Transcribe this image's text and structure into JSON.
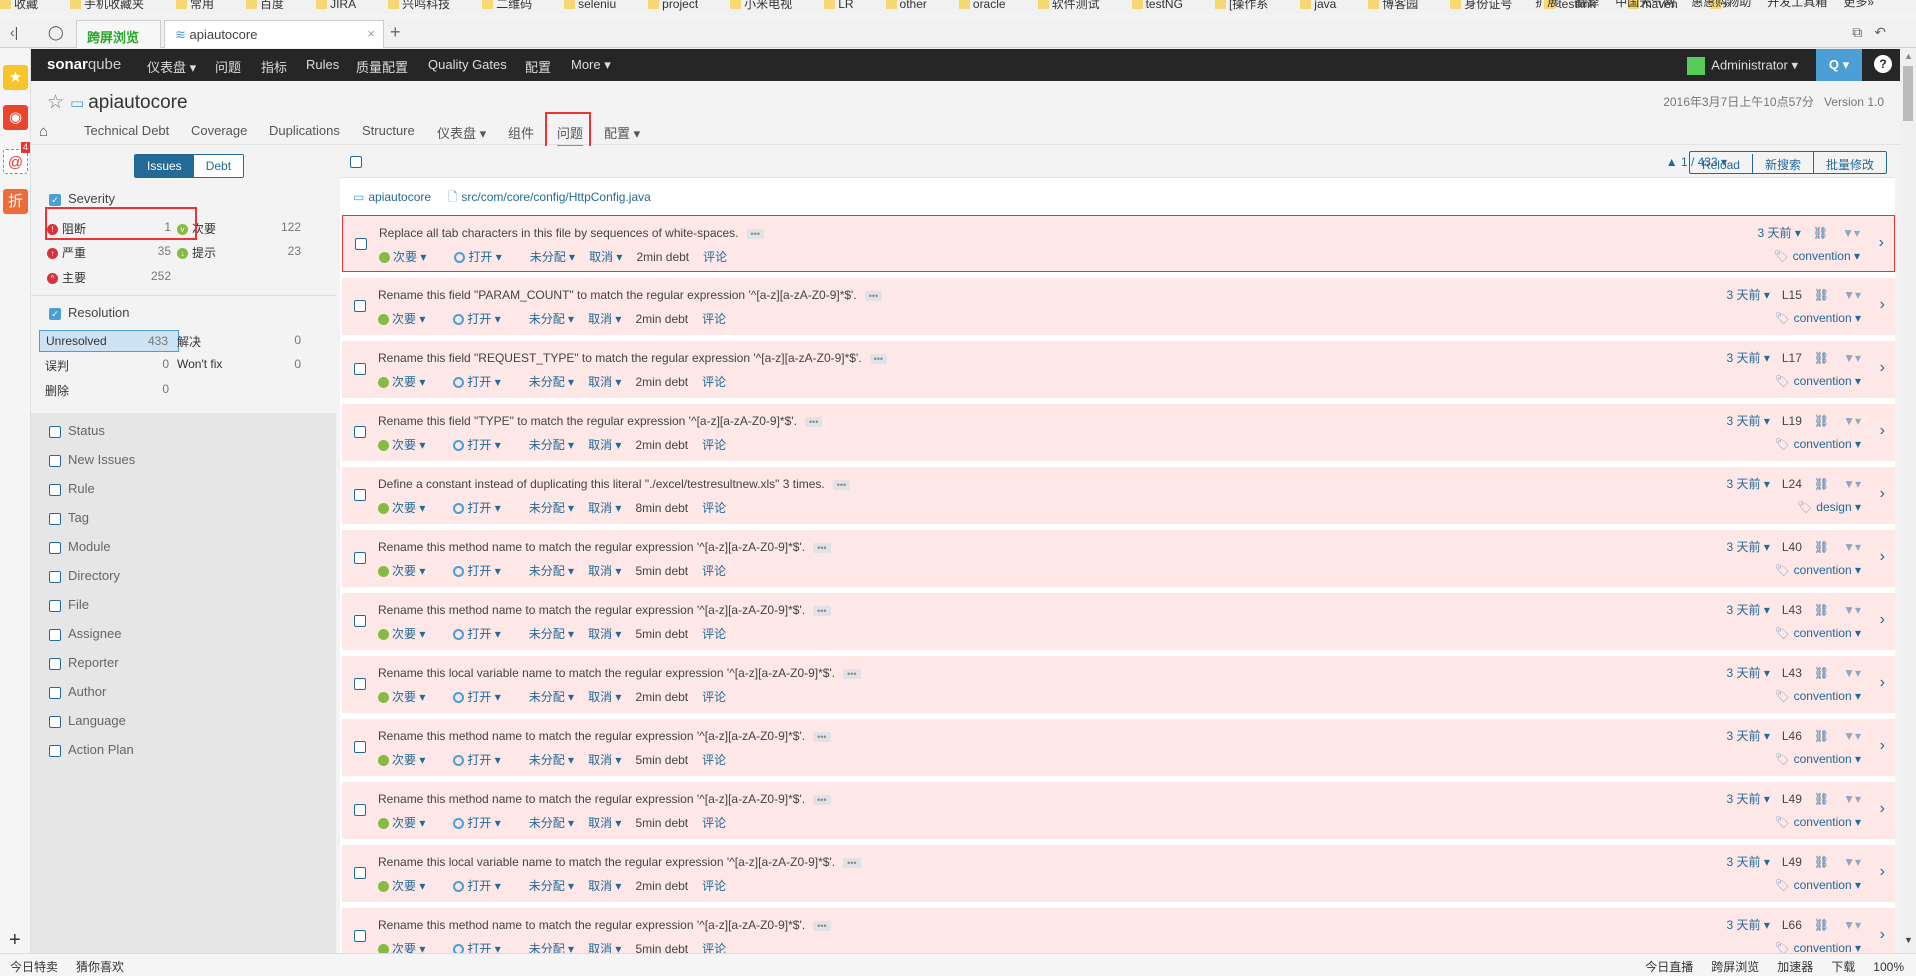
{
  "browser": {
    "bookmarks": [
      "收藏",
      "手机收藏夹",
      "常用",
      "百度",
      "JIRA",
      "兴鸣科技",
      "二维码",
      "seleniu",
      "project",
      "小米电视",
      "LR",
      "other",
      "oracle",
      "软件测试",
      "testNG",
      "[操作系",
      "java",
      "博客园",
      "身份证号",
      "testlink",
      "maven",
      "»"
    ],
    "toolbar_right": [
      "扩展",
      "翻译",
      "中国天气网",
      "惠惠购物助",
      "开发工具箱",
      "更多»"
    ],
    "tabs": [
      {
        "label": "跨屏浏览"
      },
      {
        "label": "apiautocore"
      }
    ],
    "status_left": [
      "今日特卖",
      "猜你喜欢"
    ],
    "status_right": [
      "今日直播",
      "跨屏浏览",
      "加速器",
      "下载",
      "100%"
    ],
    "app_badge": "4"
  },
  "nav": {
    "logo_a": "sonar",
    "logo_b": "qube",
    "items": [
      "仪表盘 ▾",
      "问题",
      "指标",
      "Rules",
      "质量配置",
      "Quality Gates",
      "配置",
      "More ▾"
    ],
    "user": "Administrator ▾",
    "search": "Q ▾",
    "help": "?"
  },
  "project": {
    "name": "apiautocore",
    "date": "2016年3月7日上午10点57分",
    "version": "Version 1.0",
    "subnav": [
      "Technical Debt",
      "Coverage",
      "Duplications",
      "Structure",
      "仪表盘 ▾",
      "组件",
      "问题",
      "配置 ▾"
    ]
  },
  "facets": {
    "mode": [
      "Issues",
      "Debt"
    ],
    "severity": {
      "title": "Severity",
      "items": [
        {
          "label": "阻断",
          "count": "1",
          "color": "#d4333f",
          "icon": "!"
        },
        {
          "label": "严重",
          "count": "35",
          "color": "#d4333f",
          "icon": "↑"
        },
        {
          "label": "主要",
          "count": "252",
          "color": "#d4333f",
          "icon": "^"
        },
        {
          "label": "次要",
          "count": "122",
          "color": "#85bb43",
          "icon": "v"
        },
        {
          "label": "提示",
          "count": "23",
          "color": "#85bb43",
          "icon": "↓"
        }
      ]
    },
    "resolution": {
      "title": "Resolution",
      "items": [
        {
          "label": "Unresolved",
          "count": "433"
        },
        {
          "label": "误判",
          "count": "0"
        },
        {
          "label": "删除",
          "count": "0"
        },
        {
          "label": "解决",
          "count": "0"
        },
        {
          "label": "Won't fix",
          "count": "0"
        }
      ]
    },
    "others": [
      "Status",
      "New Issues",
      "Rule",
      "Tag",
      "Module",
      "Directory",
      "File",
      "Assignee",
      "Reporter",
      "Author",
      "Language",
      "Action Plan"
    ]
  },
  "toolbar": {
    "paging": "▲ 1 / 433 ▾",
    "buttons": [
      "Reload",
      "新搜索",
      "批量修改"
    ]
  },
  "component": {
    "project": "apiautocore",
    "file": "src/com/core/config/HttpConfig.java"
  },
  "issue_labels": {
    "severity": "次要 ▾",
    "status": "打开 ▾",
    "assignee": "未分配 ▾",
    "plan": "取消 ▾",
    "comment": "评论",
    "age": "3 天前 ▾"
  },
  "issues": [
    {
      "msg": "Replace all tab characters in this file by sequences of white-spaces.",
      "debt": "2min debt",
      "line": "",
      "tag": "convention"
    },
    {
      "msg": "Rename this field \"PARAM_COUNT\" to match the regular expression '^[a-z][a-zA-Z0-9]*$'.",
      "debt": "2min debt",
      "line": "L15",
      "tag": "convention"
    },
    {
      "msg": "Rename this field \"REQUEST_TYPE\" to match the regular expression '^[a-z][a-zA-Z0-9]*$'.",
      "debt": "2min debt",
      "line": "L17",
      "tag": "convention"
    },
    {
      "msg": "Rename this field \"TYPE\" to match the regular expression '^[a-z][a-zA-Z0-9]*$'.",
      "debt": "2min debt",
      "line": "L19",
      "tag": "convention"
    },
    {
      "msg": "Define a constant instead of duplicating this literal \"./excel/testresultnew.xls\" 3 times.",
      "debt": "8min debt",
      "line": "L24",
      "tag": "design"
    },
    {
      "msg": "Rename this method name to match the regular expression '^[a-z][a-zA-Z0-9]*$'.",
      "debt": "5min debt",
      "line": "L40",
      "tag": "convention"
    },
    {
      "msg": "Rename this method name to match the regular expression '^[a-z][a-zA-Z0-9]*$'.",
      "debt": "5min debt",
      "line": "L43",
      "tag": "convention"
    },
    {
      "msg": "Rename this local variable name to match the regular expression '^[a-z][a-zA-Z0-9]*$'.",
      "debt": "2min debt",
      "line": "L43",
      "tag": "convention"
    },
    {
      "msg": "Rename this method name to match the regular expression '^[a-z][a-zA-Z0-9]*$'.",
      "debt": "5min debt",
      "line": "L46",
      "tag": "convention"
    },
    {
      "msg": "Rename this method name to match the regular expression '^[a-z][a-zA-Z0-9]*$'.",
      "debt": "5min debt",
      "line": "L49",
      "tag": "convention"
    },
    {
      "msg": "Rename this local variable name to match the regular expression '^[a-z][a-zA-Z0-9]*$'.",
      "debt": "2min debt",
      "line": "L49",
      "tag": "convention"
    },
    {
      "msg": "Rename this method name to match the regular expression '^[a-z][a-zA-Z0-9]*$'.",
      "debt": "5min debt",
      "line": "L66",
      "tag": "convention"
    }
  ]
}
